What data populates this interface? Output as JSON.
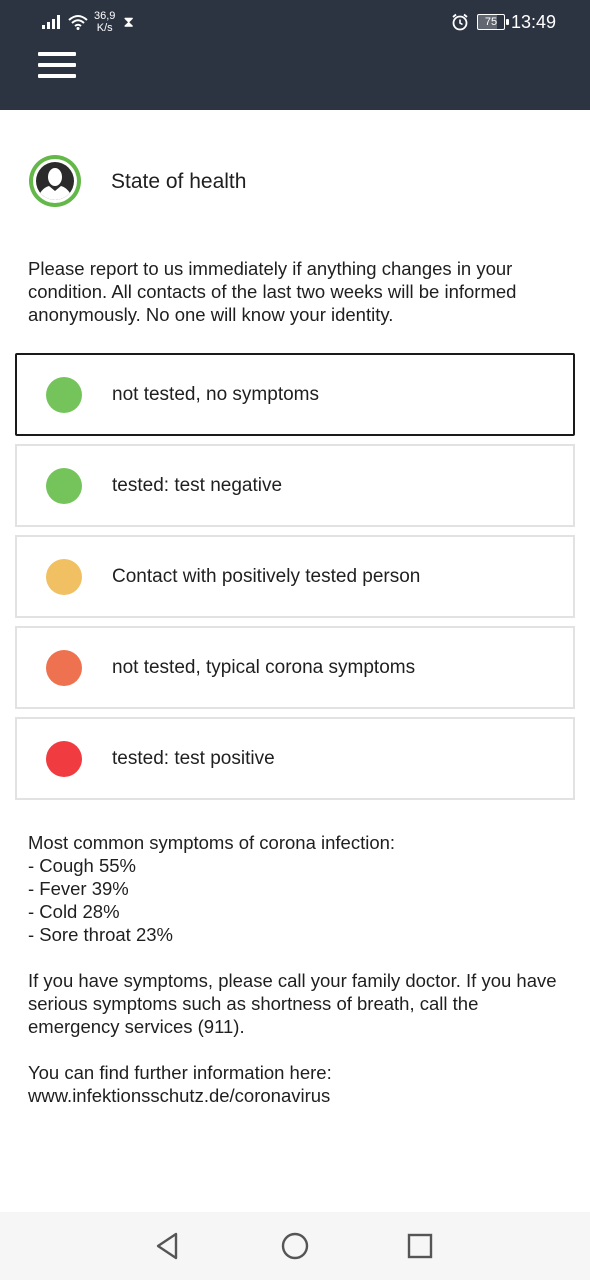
{
  "status_bar": {
    "net_speed_value": "36,9",
    "net_speed_unit": "K/s",
    "battery": "75",
    "battery_level": 0.75,
    "time": "13:49"
  },
  "header": {
    "menu_icon": "hamburger-menu-icon",
    "background": "#2c3341"
  },
  "profile": {
    "avatar_icon": "user-silhouette-icon",
    "title": "State of health",
    "ring_color": "#64b84a"
  },
  "intro_text": "Please report to us immediately if anything changes in your condition. All contacts of the last two weeks will be informed anonymously. No one will know your identity.",
  "options": [
    {
      "label": "not tested, no symptoms",
      "color": "#74c45b",
      "selected": true
    },
    {
      "label": "tested: test negative",
      "color": "#74c45b",
      "selected": false
    },
    {
      "label": "Contact with positively tested person",
      "color": "#f0c062",
      "selected": false
    },
    {
      "label": "not tested, typical corona symptoms",
      "color": "#ee7150",
      "selected": false
    },
    {
      "label": "tested: test positive",
      "color": "#f03b40",
      "selected": false
    }
  ],
  "symptoms": {
    "heading": "Most common symptoms of corona infection:",
    "items": [
      "- Cough 55%",
      "- Fever 39%",
      "- Cold 28%",
      "- Sore throat 23%"
    ]
  },
  "advice": "If you have symptoms, please call your family doctor. If you have serious symptoms such as shortness of breath, call the emergency services (911).",
  "more_info": {
    "text": "You can find further information here:",
    "link": "www.infektionsschutz.de/coronavirus"
  },
  "nav": {
    "back_icon": "back-triangle-icon",
    "home_icon": "home-circle-icon",
    "recents_icon": "recents-square-icon"
  }
}
